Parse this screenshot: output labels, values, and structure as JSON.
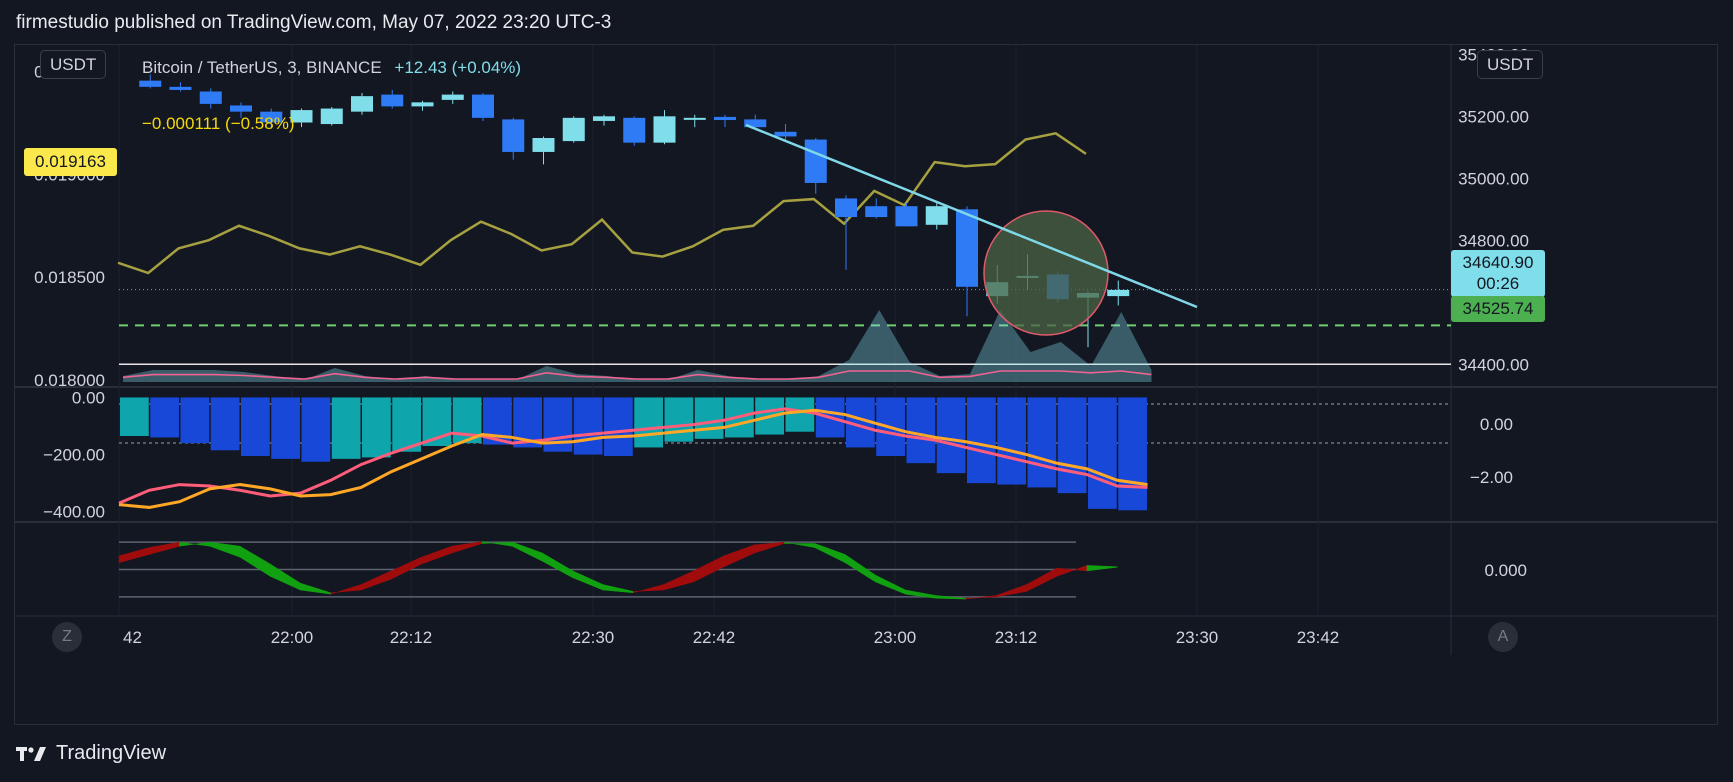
{
  "header": {
    "publisher_text": "firmestudio published on TradingView.com, May 07, 2022 23:20 UTC-3"
  },
  "footer": {
    "brand": "TradingView"
  },
  "legend": {
    "symbol_text": "Bitcoin / TetherUS, 3, BINANCE",
    "change_text": "+12.43 (+0.04%)",
    "ratio_change_text": "−0.000111 (−0.58%)"
  },
  "currency": {
    "left": "USDT",
    "right": "USDT"
  },
  "price_tags": {
    "left_ratio": "0.019163",
    "last_price": "34640.90",
    "countdown": "00:26",
    "line_price": "34525.74"
  },
  "buttons": {
    "z_label": "Z",
    "a_label": "A"
  },
  "colors": {
    "background": "#131722",
    "candle_up": "#80deea",
    "candle_down": "#2f7af5",
    "ratio_line": "#a6a041",
    "trend_line": "#7fd8e8",
    "dashed_green": "#6fcf70",
    "macd_up": "#0fa5ac",
    "macd_down": "#1848d8",
    "macd_line": "#ff5d7a",
    "signal_line": "#ffa726",
    "wave_up": "#10a010",
    "wave_down": "#a00c0c",
    "circle_fill": "#4b6444",
    "circle_stroke": "#e05a6a"
  },
  "chart_data": [
    {
      "type": "candlestick",
      "title": "Bitcoin / TetherUS, 3, BINANCE",
      "x_tick_labels": [
        "42",
        "22:00",
        "22:12",
        "22:30",
        "22:42",
        "23:00",
        "23:12",
        "23:30",
        "23:42"
      ],
      "right_axis_labels": [
        "35400.00",
        "35200.00",
        "35000.00",
        "34800.00",
        "34400.00"
      ],
      "left_axis_labels": [
        "0.019500",
        "0.019000",
        "0.018500",
        "0.018000"
      ],
      "ylim_right": [
        34330,
        35430
      ],
      "ylim_left": [
        0.01797,
        0.01963
      ],
      "candles": [
        {
          "t": "21:42",
          "o": 35315,
          "h": 35335,
          "l": 35290,
          "c": 35295
        },
        {
          "t": "21:45",
          "o": 35295,
          "h": 35310,
          "l": 35280,
          "c": 35285
        },
        {
          "t": "21:48",
          "o": 35280,
          "h": 35290,
          "l": 35225,
          "c": 35240
        },
        {
          "t": "21:51",
          "o": 35235,
          "h": 35245,
          "l": 35195,
          "c": 35215
        },
        {
          "t": "21:54",
          "o": 35215,
          "h": 35225,
          "l": 35160,
          "c": 35180
        },
        {
          "t": "21:57",
          "o": 35180,
          "h": 35225,
          "l": 35165,
          "c": 35220
        },
        {
          "t": "22:00",
          "o": 35175,
          "h": 35230,
          "l": 35170,
          "c": 35225
        },
        {
          "t": "22:03",
          "o": 35215,
          "h": 35275,
          "l": 35205,
          "c": 35265
        },
        {
          "t": "22:06",
          "o": 35270,
          "h": 35285,
          "l": 35225,
          "c": 35232
        },
        {
          "t": "22:09",
          "o": 35232,
          "h": 35250,
          "l": 35218,
          "c": 35245
        },
        {
          "t": "22:12",
          "o": 35253,
          "h": 35280,
          "l": 35240,
          "c": 35270
        },
        {
          "t": "22:15",
          "o": 35270,
          "h": 35275,
          "l": 35185,
          "c": 35195
        },
        {
          "t": "22:18",
          "o": 35190,
          "h": 35195,
          "l": 35060,
          "c": 35085
        },
        {
          "t": "22:21",
          "o": 35085,
          "h": 35135,
          "l": 35045,
          "c": 35130
        },
        {
          "t": "22:24",
          "o": 35120,
          "h": 35200,
          "l": 35115,
          "c": 35195
        },
        {
          "t": "22:27",
          "o": 35185,
          "h": 35205,
          "l": 35170,
          "c": 35200
        },
        {
          "t": "22:30",
          "o": 35195,
          "h": 35200,
          "l": 35105,
          "c": 35115
        },
        {
          "t": "22:33",
          "o": 35115,
          "h": 35220,
          "l": 35110,
          "c": 35200
        },
        {
          "t": "22:36",
          "o": 35195,
          "h": 35205,
          "l": 35165,
          "c": 35195
        },
        {
          "t": "22:39",
          "o": 35198,
          "h": 35205,
          "l": 35165,
          "c": 35188
        },
        {
          "t": "22:42",
          "o": 35190,
          "h": 35205,
          "l": 35160,
          "c": 35165
        },
        {
          "t": "22:45",
          "o": 35150,
          "h": 35175,
          "l": 35125,
          "c": 35135
        },
        {
          "t": "22:48",
          "o": 35125,
          "h": 35130,
          "l": 34950,
          "c": 34985
        },
        {
          "t": "22:51",
          "o": 34935,
          "h": 34945,
          "l": 34705,
          "c": 34875
        },
        {
          "t": "22:54",
          "o": 34910,
          "h": 34935,
          "l": 34870,
          "c": 34875
        },
        {
          "t": "22:57",
          "o": 34910,
          "h": 34920,
          "l": 34845,
          "c": 34845
        },
        {
          "t": "23:00",
          "o": 34850,
          "h": 34920,
          "l": 34835,
          "c": 34910
        },
        {
          "t": "23:03",
          "o": 34900,
          "h": 34910,
          "l": 34555,
          "c": 34650
        },
        {
          "t": "23:06",
          "o": 34620,
          "h": 34720,
          "l": 34595,
          "c": 34665
        },
        {
          "t": "23:09",
          "o": 34680,
          "h": 34755,
          "l": 34640,
          "c": 34685
        },
        {
          "t": "23:12",
          "o": 34690,
          "h": 34700,
          "l": 34600,
          "c": 34610
        },
        {
          "t": "23:15",
          "o": 34615,
          "h": 34635,
          "l": 34455,
          "c": 34630
        },
        {
          "t": "23:18",
          "o": 34620,
          "h": 34670,
          "l": 34590,
          "c": 34640
        }
      ],
      "ratio_series": [
        0.01857,
        0.01852,
        0.01864,
        0.01868,
        0.01875,
        0.0187,
        0.01864,
        0.01861,
        0.01865,
        0.01861,
        0.01856,
        0.01868,
        0.01877,
        0.01871,
        0.01863,
        0.01866,
        0.01878,
        0.01862,
        0.0186,
        0.01865,
        0.01873,
        0.01875,
        0.01887,
        0.01888,
        0.01876,
        0.01892,
        0.01885,
        0.01906,
        0.01904,
        0.01905,
        0.01917,
        0.0192,
        0.0191
      ],
      "horizontal_lines": {
        "last_price": 34640.9,
        "dashed_green": 34525.74,
        "white_line": 34400
      }
    },
    {
      "type": "bar",
      "title": "MACD",
      "left_axis_labels": [
        "0.00",
        "−200.00",
        "−400.00"
      ],
      "right_axis_labels": [
        "0.00",
        "−2.00"
      ],
      "ylim": [
        -415,
        5
      ],
      "histogram": [
        -135,
        -140,
        -160,
        -185,
        -205,
        -215,
        -225,
        -215,
        -210,
        -190,
        -170,
        -160,
        -165,
        -175,
        -190,
        -200,
        -205,
        -175,
        -155,
        -145,
        -140,
        -130,
        -120,
        -140,
        -175,
        -205,
        -230,
        -265,
        -300,
        -305,
        -315,
        -335,
        -390,
        -395
      ],
      "macd_line": [
        -370,
        -325,
        -305,
        -310,
        -325,
        -345,
        -335,
        -290,
        -235,
        -195,
        -160,
        -125,
        -135,
        -160,
        -150,
        -135,
        -125,
        -115,
        -105,
        -95,
        -80,
        -55,
        -40,
        -55,
        -85,
        -115,
        -135,
        -150,
        -175,
        -200,
        -225,
        -250,
        -270,
        -310,
        -315
      ],
      "signal_line": [
        -375,
        -385,
        -365,
        -320,
        -305,
        -320,
        -345,
        -340,
        -315,
        -260,
        -215,
        -170,
        -130,
        -140,
        -160,
        -155,
        -140,
        -135,
        -125,
        -115,
        -105,
        -80,
        -55,
        -45,
        -60,
        -90,
        -120,
        -140,
        -155,
        -175,
        -200,
        -230,
        -250,
        -290,
        -305
      ]
    },
    {
      "type": "area",
      "title": "Oscillator",
      "right_axis_labels": [
        "0.000"
      ],
      "ylim": [
        -1.15,
        1.15
      ],
      "levels": [
        1,
        0,
        -1
      ],
      "fast_line": [
        0.25,
        0.55,
        0.85,
        1.0,
        0.85,
        0.2,
        -0.5,
        -0.85,
        -0.75,
        -0.35,
        0.2,
        0.6,
        0.95,
        1.0,
        0.6,
        -0.05,
        -0.55,
        -0.8,
        -0.75,
        -0.45,
        0.1,
        0.6,
        0.95,
        0.95,
        0.55,
        -0.2,
        -0.75,
        -0.95,
        -1.05,
        -1.0,
        -0.8,
        -0.25,
        0.15,
        0.1
      ],
      "slow_line": [
        0.5,
        0.8,
        1.0,
        0.85,
        0.45,
        -0.25,
        -0.75,
        -0.9,
        -0.55,
        -0.05,
        0.45,
        0.85,
        1.02,
        0.85,
        0.3,
        -0.3,
        -0.75,
        -0.85,
        -0.55,
        -0.05,
        0.5,
        0.9,
        1.0,
        0.8,
        0.25,
        -0.45,
        -0.9,
        -1.05,
        -1.08,
        -0.95,
        -0.55,
        0.05,
        -0.05,
        0.08
      ]
    }
  ]
}
